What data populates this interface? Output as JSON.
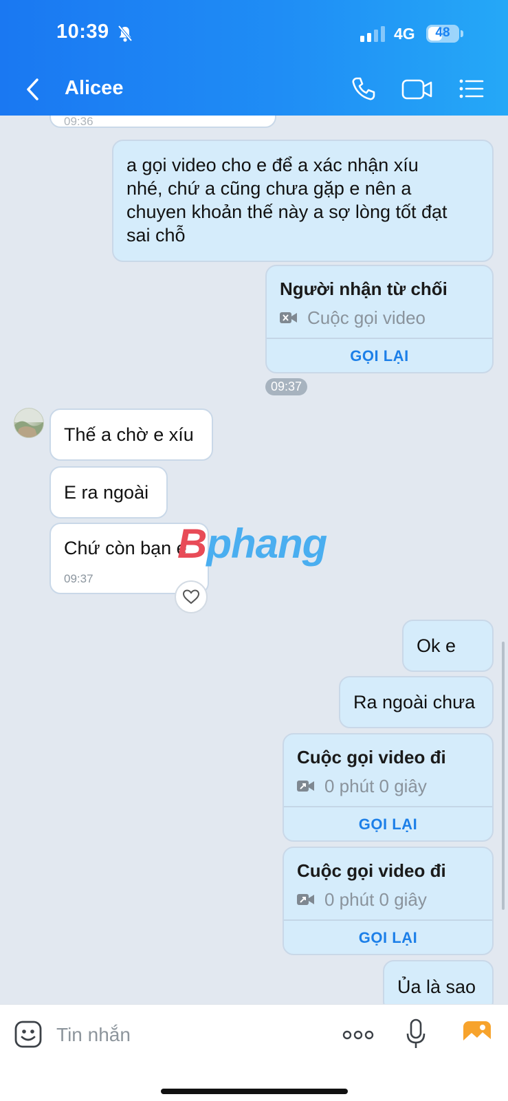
{
  "status_bar": {
    "time": "10:39",
    "network": "4G",
    "battery": "48",
    "battery_level": 0.48
  },
  "header": {
    "contact_name": "Alicee"
  },
  "messages": {
    "m0_time": "09:36",
    "m1_lines": [
      "a gọi video cho e để a xác nhận xíu",
      "nhé, chứ a cũng chưa gặp e nên a",
      "chuyen khoản thế này a sợ lòng tốt đạt",
      "sai chỗ"
    ],
    "call1": {
      "title": "Người nhận từ chối",
      "subtitle": "Cuộc gọi video",
      "action": "GỌI LẠI"
    },
    "time_pill": "09:37",
    "t1": "Thế a chờ e xíu",
    "t2": "E ra ngoài",
    "t3": "Chứ còn bạn e",
    "t3_time": "09:37",
    "m2": "Ok e",
    "m3": "Ra ngoài chưa",
    "call2": {
      "title": "Cuộc gọi video đi",
      "subtitle": "0 phút 0 giây",
      "action": "GỌI LẠI"
    },
    "call3": {
      "title": "Cuộc gọi video đi",
      "subtitle": "0 phút 0 giây",
      "action": "GỌI LẠI"
    },
    "m4_partial": "Ủa là sao"
  },
  "watermark": {
    "part1": "B",
    "part2": "phang"
  },
  "input": {
    "placeholder": "Tin nhắn"
  },
  "colors": {
    "header_start": "#1a78f2",
    "header_end": "#25a8f7",
    "my_bubble": "#d5ecfb",
    "their_bubble": "#ffffff",
    "accent": "#1c7fe8"
  },
  "icons": [
    "back-icon",
    "phone-icon",
    "video-call-icon",
    "menu-icon",
    "video-camera-icon",
    "heart-icon",
    "sticker-icon",
    "more-icon",
    "microphone-icon",
    "image-icon",
    "bell-off-icon",
    "signal-icon"
  ]
}
